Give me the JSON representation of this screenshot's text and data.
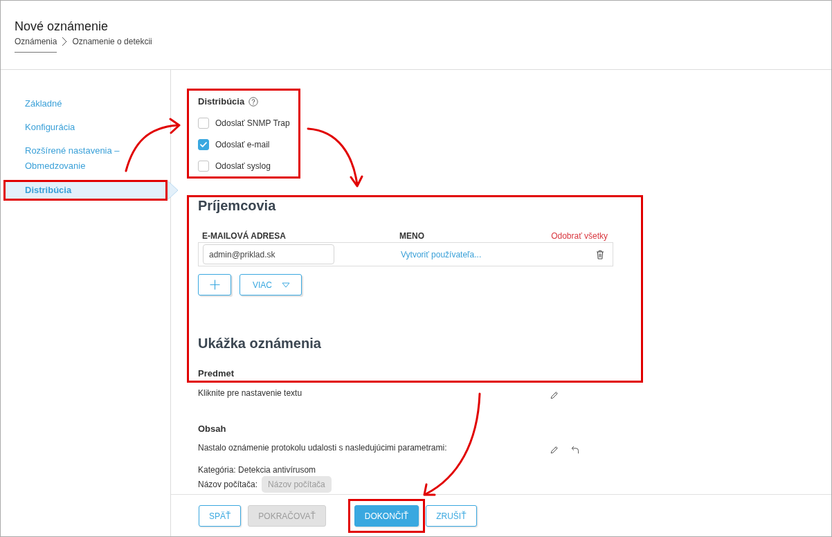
{
  "header": {
    "title": "Nové oznámenie",
    "breadcrumb": [
      {
        "label": "Oznámenia",
        "kind": "link"
      },
      {
        "label": "Oznamenie o detekcii",
        "kind": "current"
      }
    ]
  },
  "sidebar": {
    "items": [
      {
        "label": "Základné",
        "selected": false,
        "highlighted": false
      },
      {
        "label": "Konfigurácia",
        "selected": false,
        "highlighted": false
      },
      {
        "label": "Rozšírené nastavenia – Obmedzovanie",
        "selected": false,
        "highlighted": false
      },
      {
        "label": "Distribúcia",
        "selected": true,
        "highlighted": true
      }
    ]
  },
  "distribution": {
    "title": "Distribúcia",
    "highlighted": true,
    "options": [
      {
        "label": "Odoslať SNMP Trap",
        "checked": false
      },
      {
        "label": "Odoslať e-mail",
        "checked": true
      },
      {
        "label": "Odoslať syslog",
        "checked": false
      }
    ]
  },
  "recipients": {
    "title": "Príjemcovia",
    "highlighted": true,
    "columns": [
      "E-MAILOVÁ ADRESA",
      "MENO"
    ],
    "remove_all": "Odobrať všetky",
    "rows": [
      {
        "email": "admin@priklad.sk",
        "action": "Vytvoriť používateľa..."
      }
    ],
    "more_button": "VIAC"
  },
  "preview": {
    "title": "Ukážka oznámenia",
    "fields": [
      {
        "label": "Predmet",
        "paragraphs": [
          [
            {
              "text": "Kliknite pre nastavenie textu"
            }
          ]
        ],
        "resettable": false
      },
      {
        "label": "Obsah",
        "paragraphs": [
          [
            {
              "text": "Nastalo oznámenie protokolu udalosti s nasledujúcimi parametrami:"
            }
          ],
          [
            {
              "text": "Kategória: Detekcia antivírusom"
            },
            {
              "text": "Názov počítača:",
              "chip": "Názov počítača"
            }
          ]
        ],
        "resettable": true
      }
    ]
  },
  "footer": {
    "buttons": [
      {
        "label": "SPÄŤ",
        "kind": "secondary",
        "disabled": false,
        "highlighted": false
      },
      {
        "label": "POKRAČOVAŤ",
        "kind": "secondary",
        "disabled": true,
        "highlighted": false
      },
      {
        "label": "DOKONČIŤ",
        "kind": "primary",
        "disabled": false,
        "highlighted": true
      },
      {
        "label": "ZRUŠIŤ",
        "kind": "secondary",
        "disabled": false,
        "highlighted": false
      }
    ]
  }
}
